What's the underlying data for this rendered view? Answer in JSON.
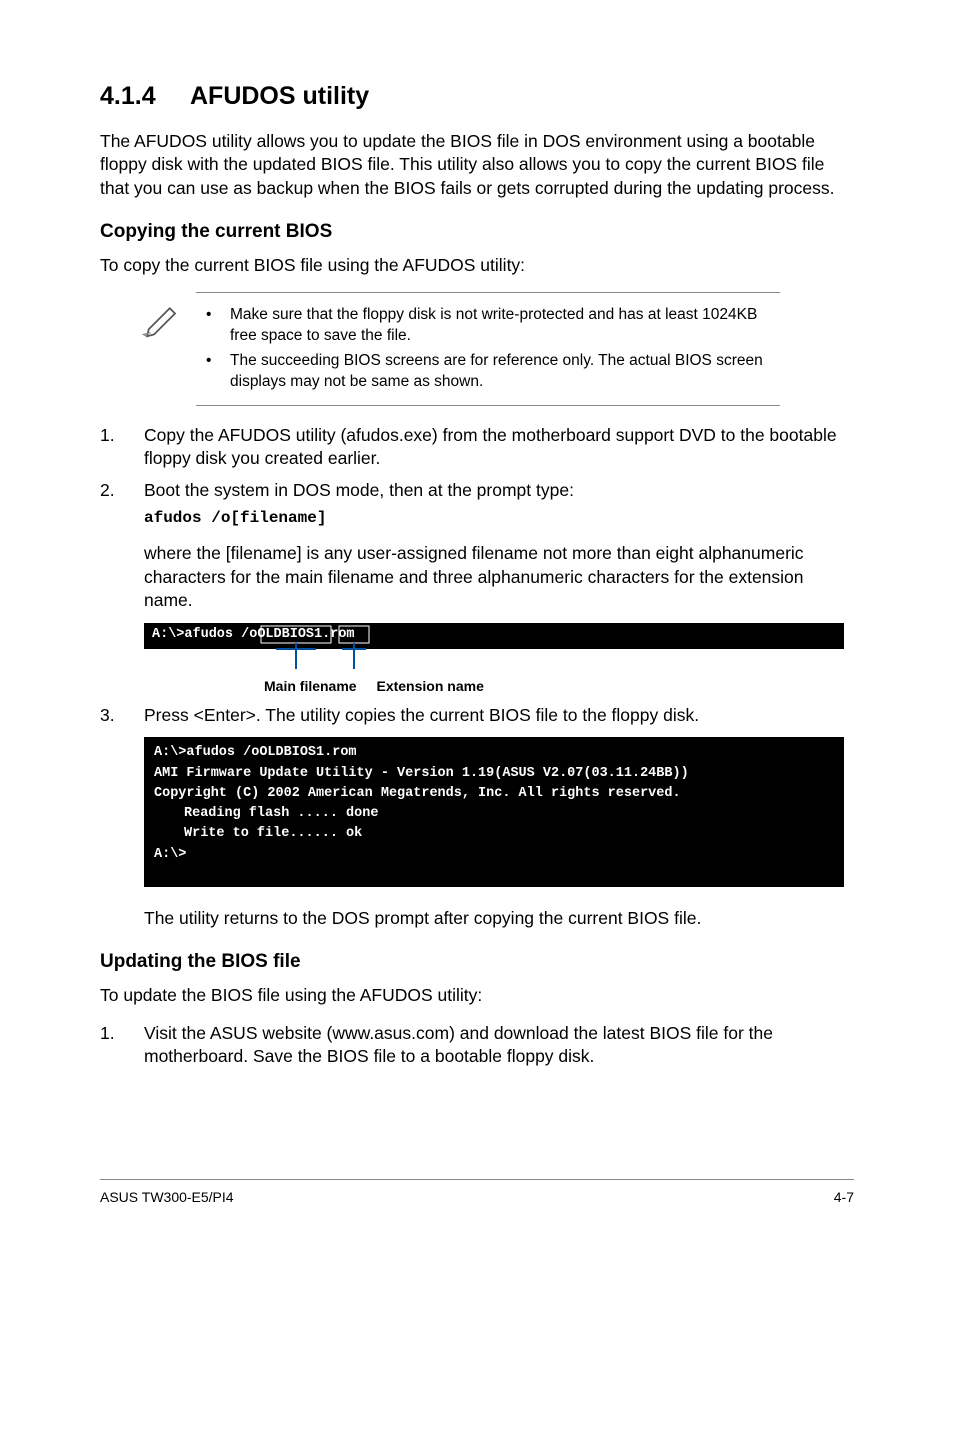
{
  "section": {
    "number": "4.1.4",
    "title": "AFUDOS utility"
  },
  "intro": "The AFUDOS utility allows you to update the BIOS file in DOS environment using a bootable floppy disk with the updated BIOS file. This utility also allows you to copy the current BIOS file that you can use as backup when the BIOS fails or gets corrupted during the updating process.",
  "copy_heading": "Copying the current BIOS",
  "copy_para": "To copy the current BIOS file using the AFUDOS utility:",
  "notes": [
    "Make sure that the floppy disk is not write-protected and has at least 1024KB free space to save the file.",
    "The succeeding BIOS screens are for reference only. The actual BIOS screen displays may not be same as shown."
  ],
  "steps_a": [
    {
      "n": "1.",
      "text": "Copy the AFUDOS utility (afudos.exe) from the motherboard support DVD to the bootable floppy disk you created earlier."
    },
    {
      "n": "2.",
      "text": "Boot the system in DOS mode, then at the prompt type:",
      "code": "afudos /o[filename]",
      "after": "where the [filename] is any user-assigned filename not more than eight alphanumeric characters  for the main filename and three alphanumeric characters for the extension name."
    }
  ],
  "term1": "A:\\>afudos /oOLDBIOS1.rom",
  "ext_labels": {
    "main": "Main filename",
    "ext": "Extension name"
  },
  "step3": {
    "n": "3.",
    "text": "Press <Enter>. The utility copies the current BIOS file to the floppy disk."
  },
  "term2": {
    "l1": "A:\\>afudos /oOLDBIOS1.rom",
    "l2": "AMI Firmware Update Utility - Version 1.19(ASUS V2.07(03.11.24BB))",
    "l3": "Copyright (C) 2002 American Megatrends, Inc. All rights reserved.",
    "l4": "Reading flash ..... done",
    "l5": "Write to file...... ok",
    "l6": "A:\\>"
  },
  "after_term2": "The utility returns to the DOS prompt after copying the current BIOS file.",
  "update_heading": "Updating the BIOS file",
  "update_para": "To update the BIOS file using the AFUDOS utility:",
  "steps_b": [
    {
      "n": "1.",
      "text": "Visit the ASUS website (www.asus.com) and download the latest BIOS file for the motherboard. Save the BIOS file to a bootable floppy disk."
    }
  ],
  "footer": {
    "left": "ASUS TW300-E5/PI4",
    "right": "4-7"
  }
}
